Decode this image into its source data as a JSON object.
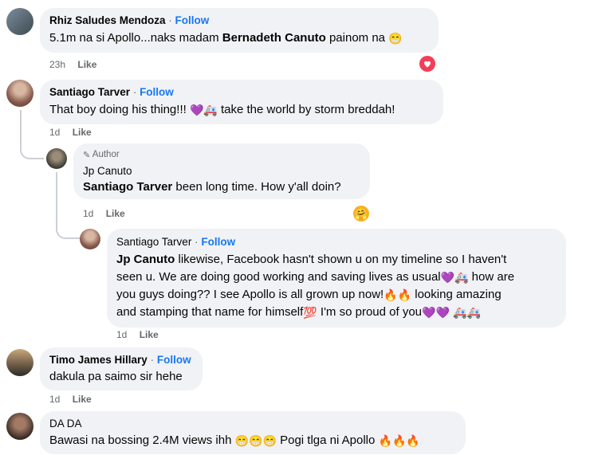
{
  "comments": [
    {
      "author": "Rhiz Saludes Mendoza",
      "follow": "Follow",
      "text_pre": "5.1m na si Apollo...naks madam ",
      "mention": "Bernadeth Canuto",
      "text_post": " painom na ",
      "time": "23h",
      "like": "Like",
      "reaction": "heart-reaction"
    },
    {
      "author": "Santiago Tarver",
      "follow": "Follow",
      "text_pre": "That boy doing his thing!!! ",
      "text_post": " take the world by storm breddah!",
      "time": "1d",
      "like": "Like",
      "replies": [
        {
          "badge": "Author",
          "author": "Jp Canuto",
          "mention": "Santiago Tarver",
          "text_post": " been long time. How y'all doin?",
          "time": "1d",
          "like": "Like",
          "reaction": "hug-reaction"
        },
        {
          "author": "Santiago Tarver",
          "follow": "Follow",
          "mention": "Jp Canuto",
          "line1": " likewise, Facebook hasn't shown u on my timeline so I haven't",
          "line2_pre": "seen u. We are doing good working and saving lives as usual",
          "line2_post": " how are",
          "line3_pre": "you guys doing?? I see Apollo is all grown up now!",
          "line3_post": " looking amazing",
          "line4_pre": "and stamping that name for himself",
          "line4_post": " I'm so proud of you",
          "time": "1d",
          "like": "Like"
        }
      ]
    },
    {
      "author": "Timo James Hillary",
      "follow": "Follow",
      "text": "dakula pa saimo sir hehe",
      "time": "1d",
      "like": "Like"
    },
    {
      "author": "DA DA",
      "text_pre": "Bawasi na bossing 2.4M views ihh ",
      "text_mid": " Pogi tlga ni Apollo "
    }
  ],
  "colors": {
    "follow": "#1877f2",
    "bubble": "#f0f2f5",
    "meta": "#65676b",
    "heart": "#f33e58"
  }
}
